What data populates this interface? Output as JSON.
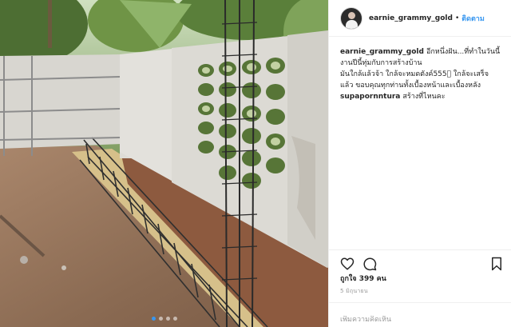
{
  "post": {
    "username": "earnie_grammy_gold",
    "separator": "•",
    "follow_label": "ติดตาม",
    "caption": {
      "user": "earnie_grammy_gold",
      "lines": [
        "อีกหนึ่งฝัน...ที่ทำในวันนี้",
        "งานปีนี้ทุ่มกับการสร้างบ้าน",
        "มันใกล้แล้วจ้า ใกล้จะหมดตังค์555🏻 ใกล้จะเสร็จ",
        "แล้ว ขอบคุณทุกท่านทั้งเบื้องหน้าและเบื้องหลัง"
      ]
    },
    "reply": {
      "user": "supapornntura",
      "text": "สร้างที่ไหนคะ"
    },
    "likes_text": "ถูกใจ 399 คน",
    "date_text": "5 มิถุนายน",
    "comment_placeholder": "เพิ่มความคิดเห็น",
    "icons": {
      "like": "heart-icon",
      "comment": "comment-bubble-icon",
      "save": "bookmark-icon"
    },
    "carousel_slides": 4,
    "carousel_active": 1
  },
  "colors": {
    "link": "#3897f0",
    "text": "#262626",
    "muted": "#999999",
    "border": "#efefef"
  }
}
